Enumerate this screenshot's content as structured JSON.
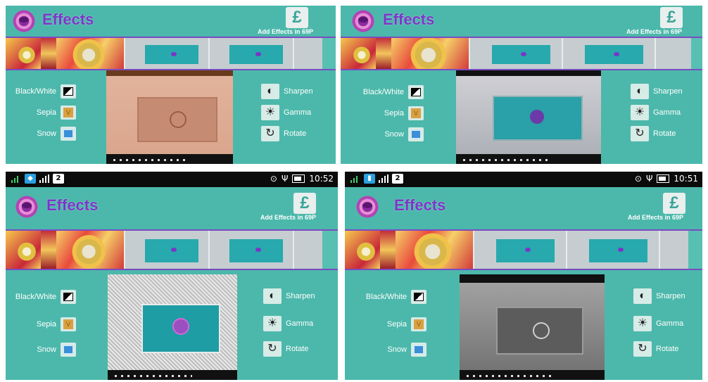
{
  "app": {
    "title": "Effects",
    "add_effects_label": "Add Effects in 69P",
    "pound_symbol": "£",
    "accent_color": "#7a35c7",
    "background_color": "#4cb8ab"
  },
  "left_controls": [
    {
      "label": "Black/White",
      "icon": "black-white-icon"
    },
    {
      "label": "Sepia",
      "icon": "sepia-icon"
    },
    {
      "label": "Snow",
      "icon": "snow-icon"
    }
  ],
  "right_controls": [
    {
      "label": "Sharpen",
      "icon": "sharpen-icon"
    },
    {
      "label": "Gamma",
      "icon": "gamma-icon"
    },
    {
      "label": "Rotate",
      "icon": "rotate-icon"
    }
  ],
  "status_bars": [
    {
      "badge": "2",
      "time": "10:52"
    },
    {
      "badge": "2",
      "time": "10:51"
    }
  ]
}
